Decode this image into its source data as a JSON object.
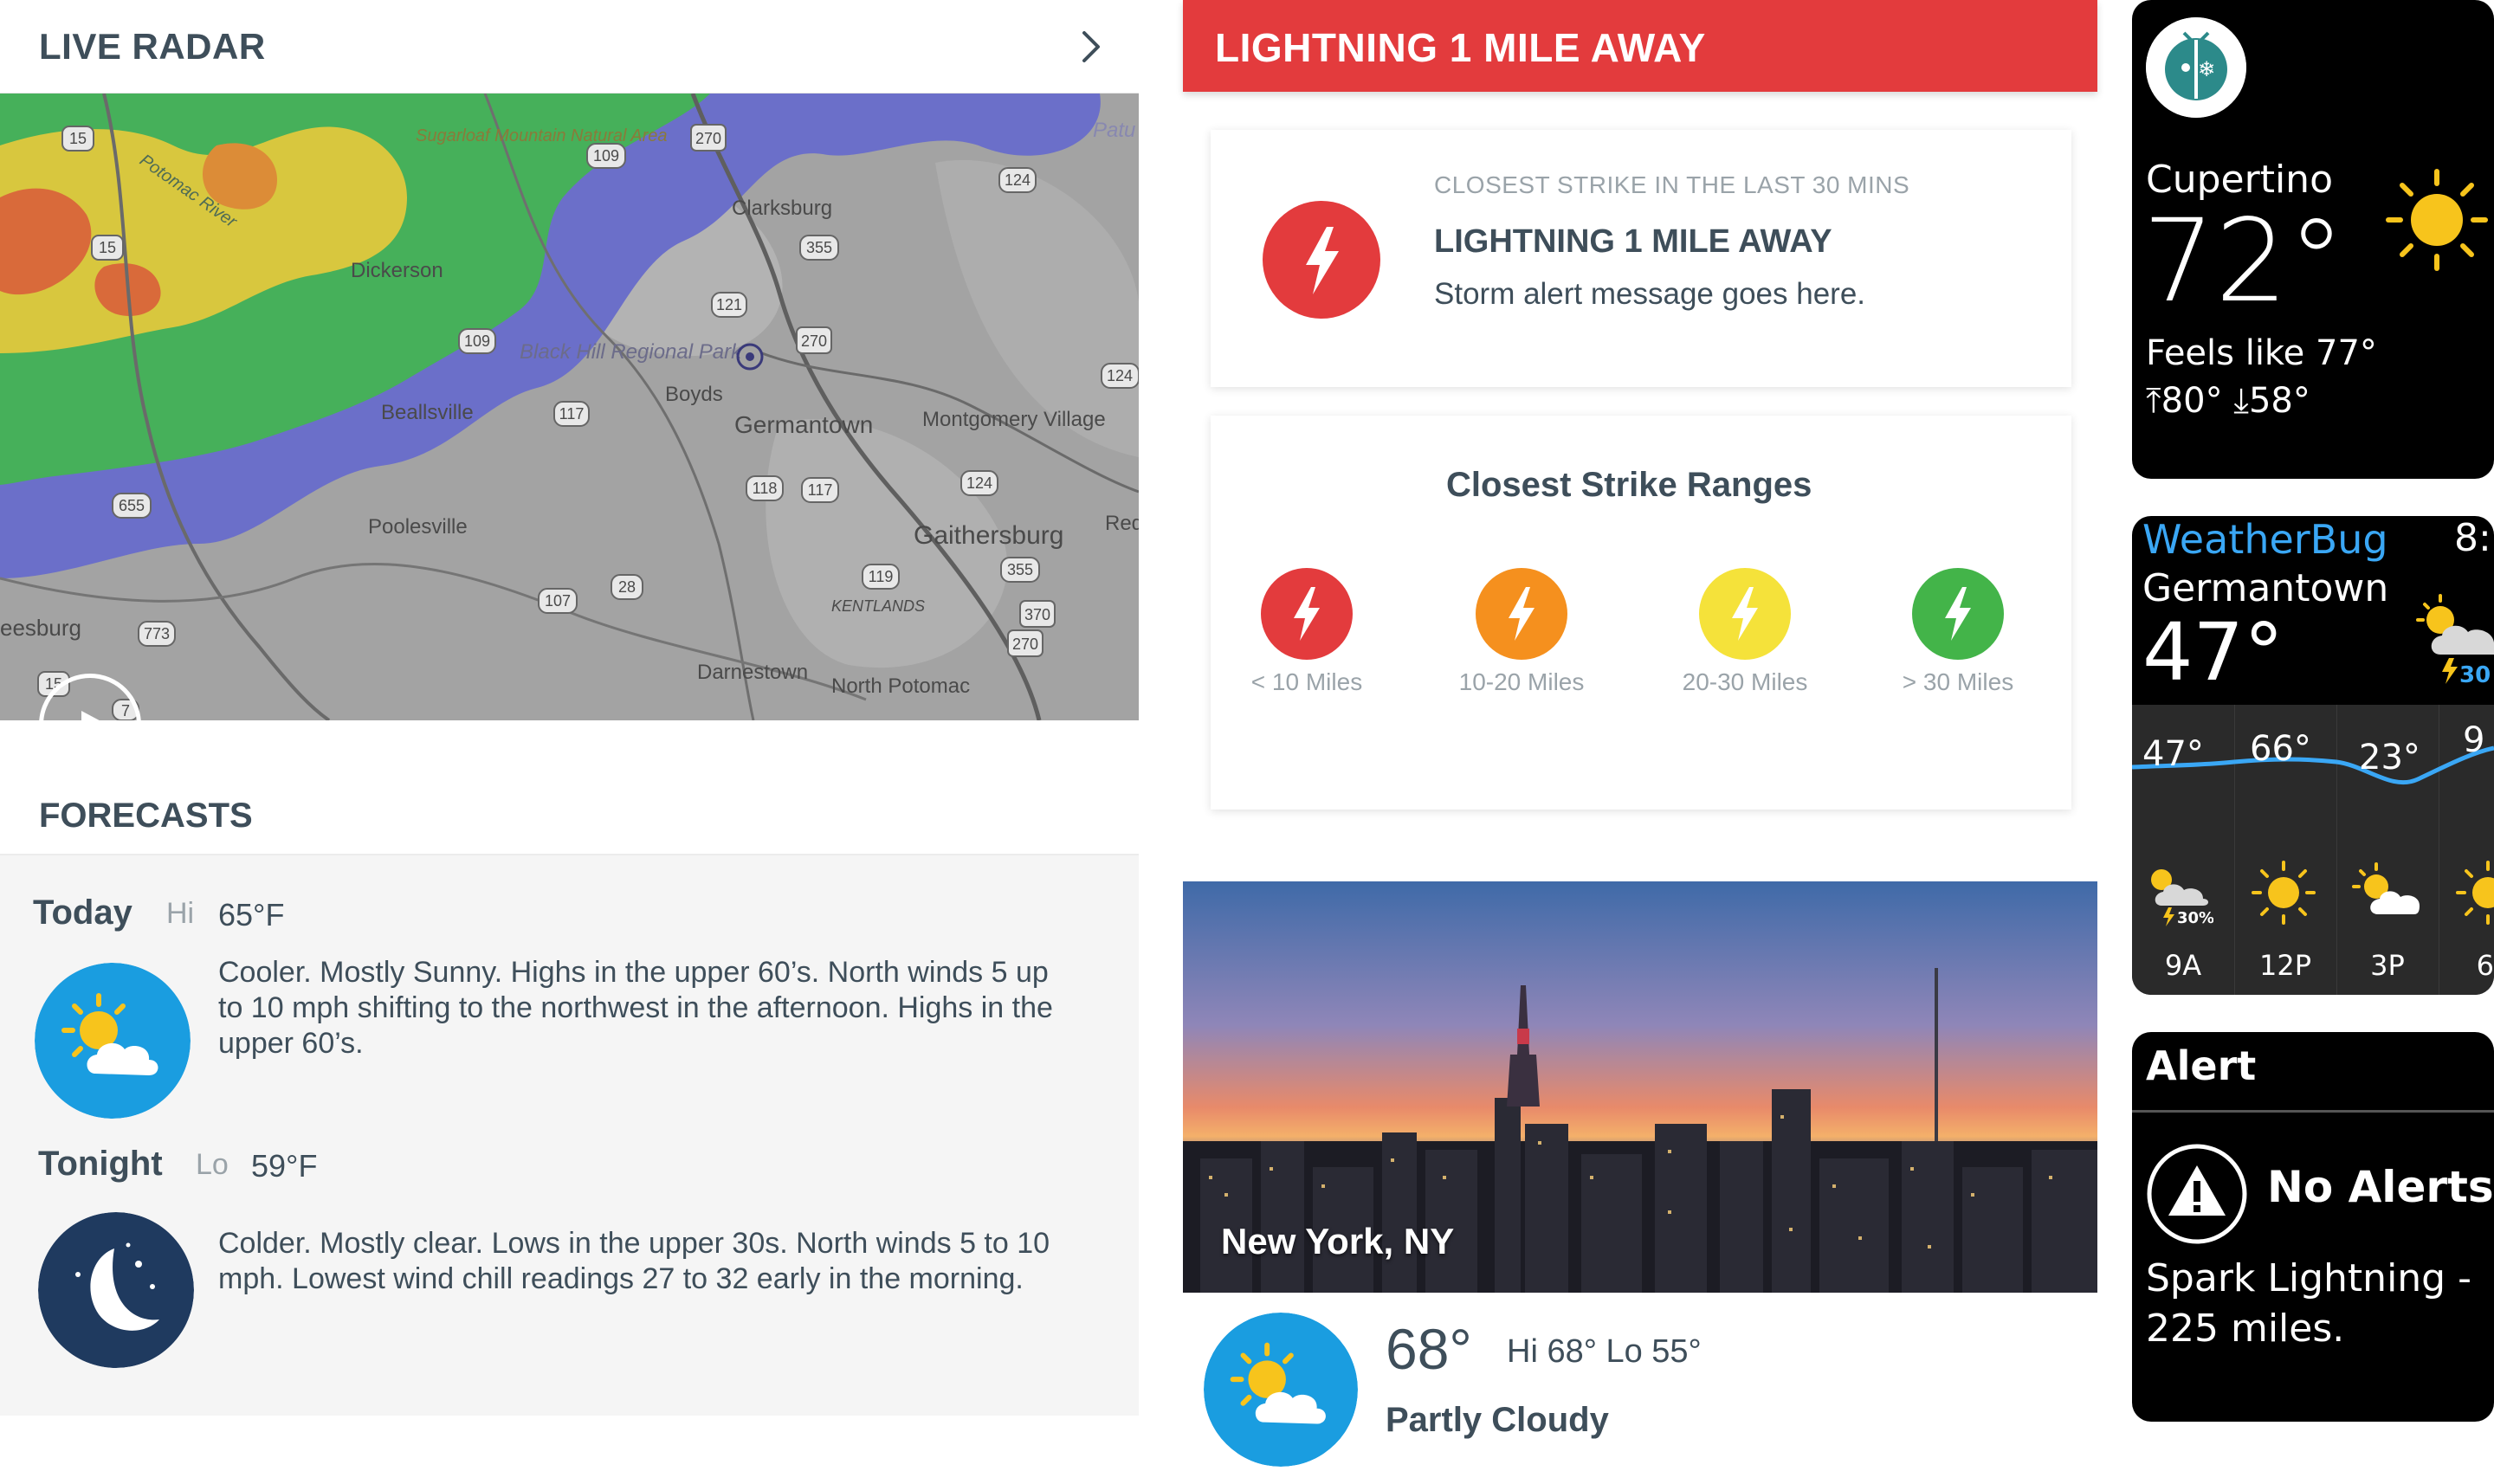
{
  "radar": {
    "title": "LIVE RADAR",
    "map_labels": [
      "Sugarloaf Mountain Natural Area",
      "Potomac River",
      "Clarksburg",
      "Dickerson",
      "Black Hill Regional Park",
      "Boyds",
      "Beallsville",
      "Germantown",
      "Montgomery Village",
      "Poolesville",
      "Gaithersburg",
      "KENTLANDS",
      "Darnestown",
      "North Potomac",
      "eesburg",
      "Patu",
      "Red"
    ],
    "route_shields": [
      "15",
      "109",
      "270",
      "124",
      "355",
      "121",
      "270",
      "109",
      "117",
      "124",
      "118",
      "117",
      "124",
      "355",
      "119",
      "655",
      "28",
      "107",
      "370",
      "773",
      "270",
      "15",
      "7",
      "15"
    ]
  },
  "forecasts": {
    "title": "FORECASTS",
    "items": [
      {
        "day": "Today",
        "hilo_label": "Hi",
        "temp": "65°F",
        "desc_lines": [
          "Cooler. Mostly Sunny. Highs in the upper 60’s. North winds 5 up",
          "to 10 mph shifting to the northwest in the afternoon. Highs in the",
          "upper 60’s."
        ],
        "icon": "partly-sunny-icon"
      },
      {
        "day": "Tonight",
        "hilo_label": "Lo",
        "temp": "59°F",
        "desc_lines": [
          "Colder. Mostly clear. Lows in the upper 30s. North winds 5 to 10",
          "mph. Lowest wind chill readings 27 to 32 early in the morning."
        ],
        "icon": "moon-stars-icon"
      }
    ]
  },
  "lightning": {
    "banner": "LIGHTNING 1 MILE AWAY",
    "card": {
      "subtitle": "CLOSEST STRIKE IN THE LAST 30 MINS",
      "title": "LIGHTNING 1 MILE AWAY",
      "message": "Storm alert message goes here."
    },
    "ranges": {
      "title": "Closest Strike Ranges",
      "items": [
        {
          "label": "< 10 Miles",
          "color": "#e33b3d"
        },
        {
          "label": "10-20 Miles",
          "color": "#f5901e"
        },
        {
          "label": "20-30 Miles",
          "color": "#f5e23a"
        },
        {
          "label": "> 30 Miles",
          "color": "#43b449"
        }
      ]
    }
  },
  "city": {
    "name": "New York, NY",
    "temp": "68°",
    "hilo": "Hi 68°  Lo 55°",
    "condition": "Partly Cloudy"
  },
  "watch1": {
    "city": "Cupertino",
    "temp": "72°",
    "feels": "Feels like 77°",
    "hilo": "⤒80°  ⤓58°"
  },
  "watch2": {
    "brand": "WeatherBug",
    "time": "8:",
    "city": "Germantown",
    "temp": "47°",
    "side_badge": "30",
    "hourly": [
      {
        "temp": "47°",
        "time": "9A",
        "precip": "30%"
      },
      {
        "temp": "66°",
        "time": "12P"
      },
      {
        "temp": "23°",
        "time": "3P"
      },
      {
        "temp": "9",
        "time": "6"
      }
    ]
  },
  "watch3": {
    "title": "Alert",
    "status": "No Alerts",
    "message": "Spark Lightning - 225 miles."
  },
  "colors": {
    "accent_red": "#e33b3d",
    "icon_blue": "#1a9de0",
    "night_navy": "#1f3a5f",
    "brand_blue": "#3aa7f5"
  }
}
